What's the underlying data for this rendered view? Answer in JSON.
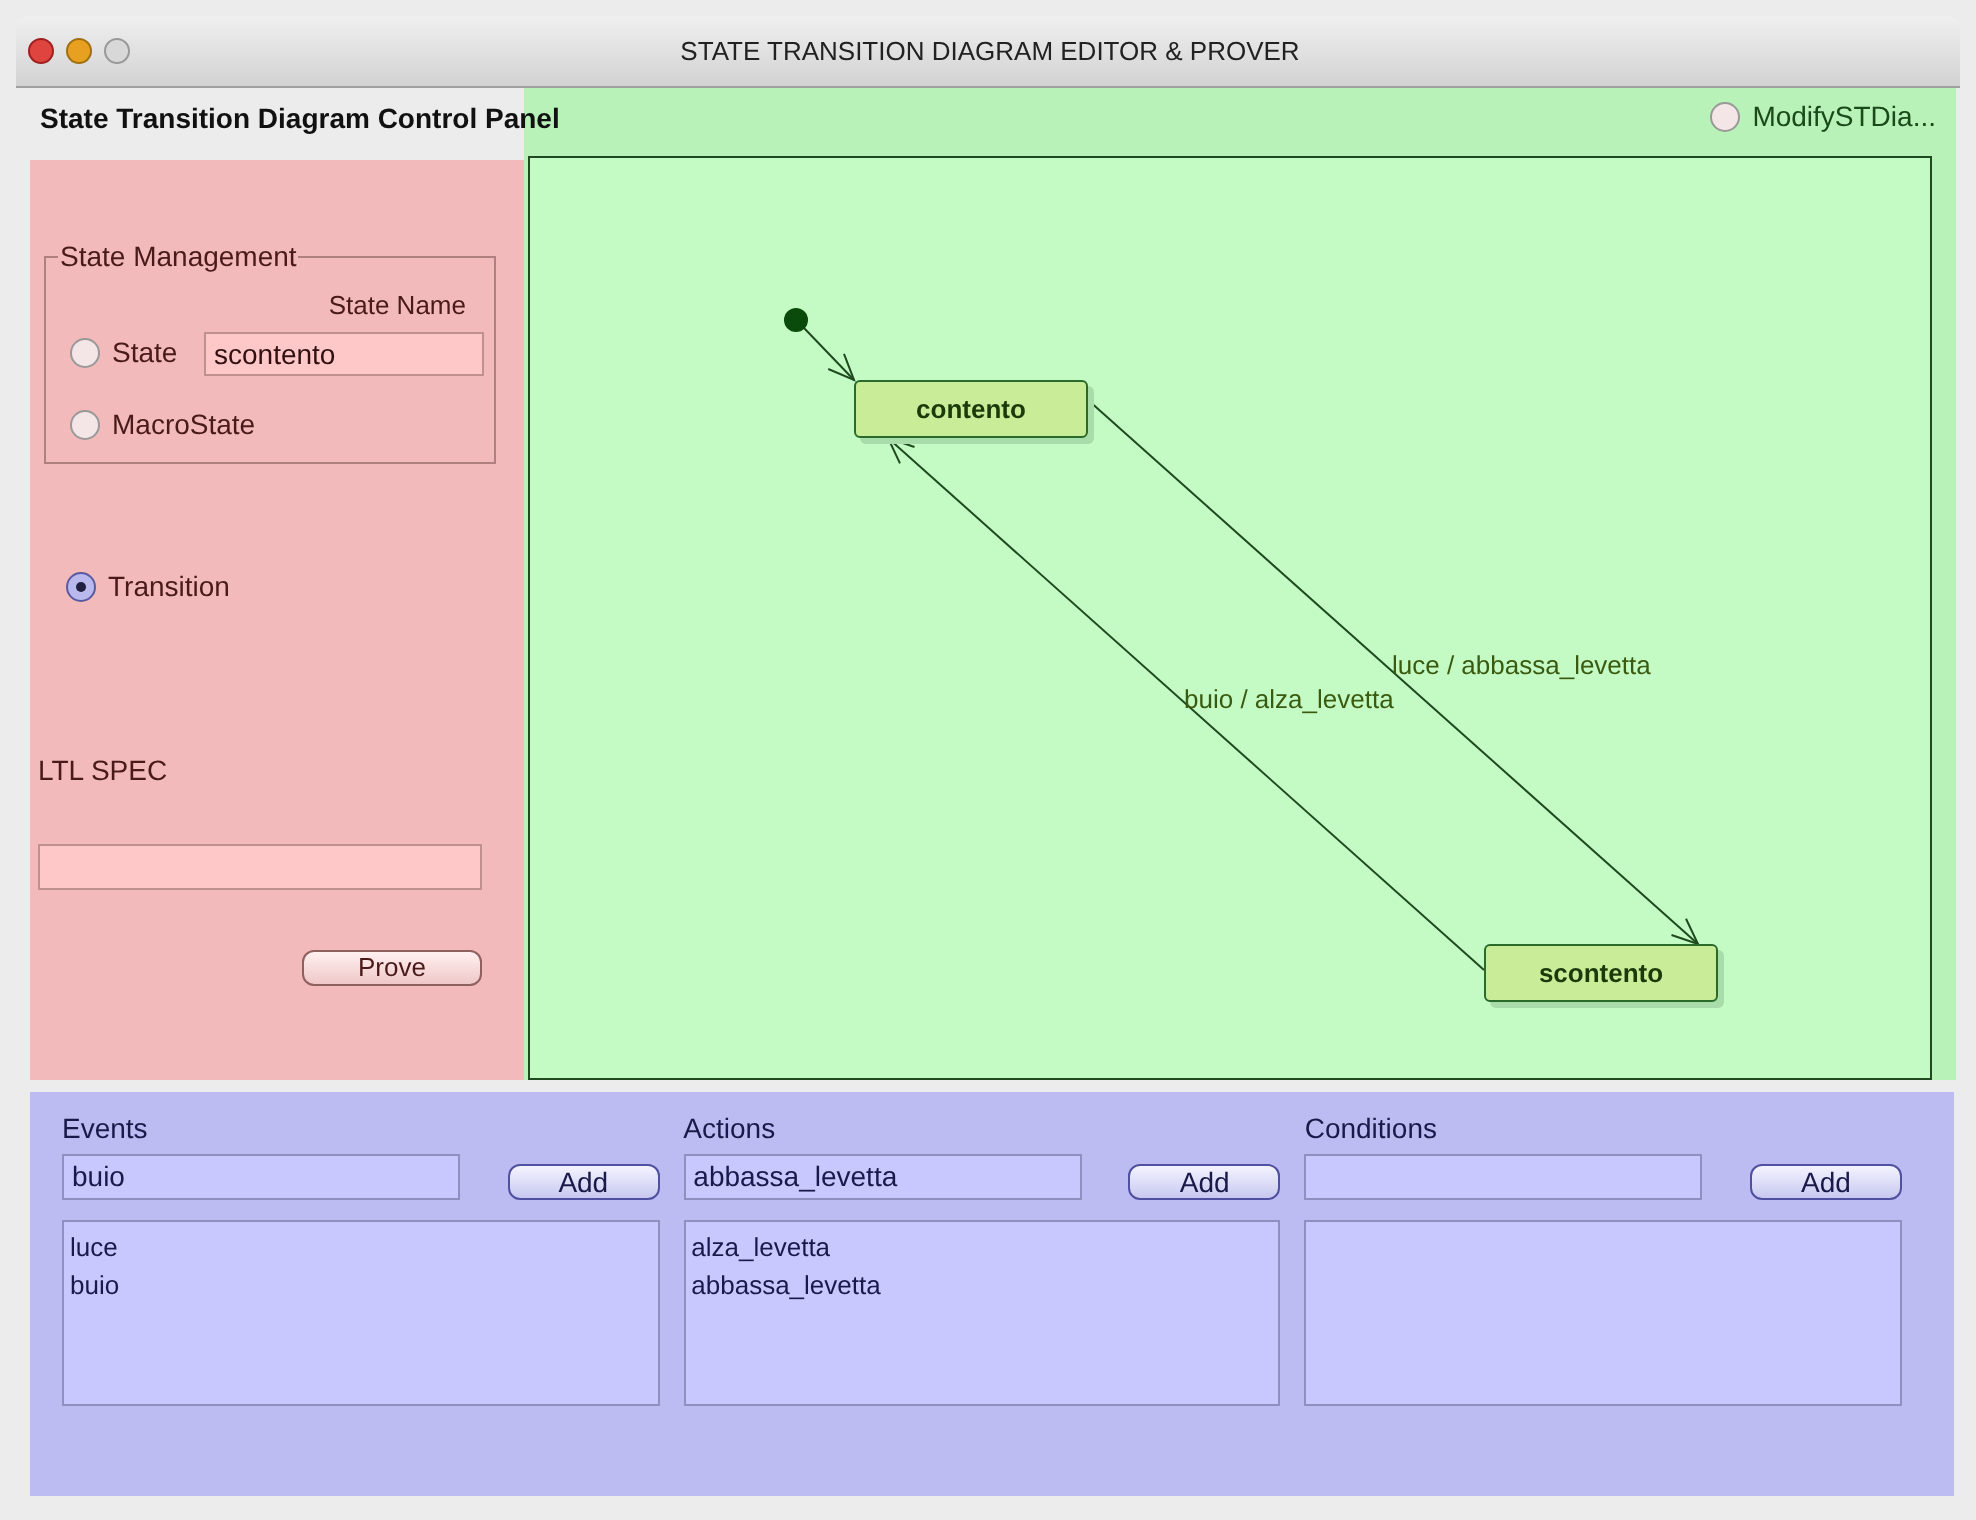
{
  "window": {
    "title": "STATE TRANSITION DIAGRAM EDITOR & PROVER"
  },
  "control_panel": {
    "title": "State Transition Diagram Control Panel",
    "state_management": {
      "title": "State Management",
      "state_name_label": "State Name",
      "state_name_value": "scontento"
    },
    "radios": [
      {
        "label": "State",
        "selected": false
      },
      {
        "label": "MacroState",
        "selected": false
      },
      {
        "label": "Transition",
        "selected": true
      }
    ],
    "ltl_spec": {
      "label": "LTL SPEC"
    },
    "prove_button": "Prove"
  },
  "modify_toggle": {
    "label": "ModifySTDia...",
    "selected": false
  },
  "diagram": {
    "states": [
      {
        "name": "contento"
      },
      {
        "name": "scontento"
      }
    ],
    "transitions": [
      {
        "label": "luce / abbassa_levetta"
      },
      {
        "label": "buio / alza_levetta"
      }
    ]
  },
  "lists": [
    {
      "title": "Events",
      "value": "buio",
      "button": "Add",
      "items": [
        "luce",
        "buio"
      ]
    },
    {
      "title": "Actions",
      "value": "abbassa_levetta",
      "button": "Add",
      "items": [
        "alza_levetta",
        "abbassa_levetta"
      ]
    },
    {
      "title": "Conditions",
      "button": "Add"
    }
  ]
}
